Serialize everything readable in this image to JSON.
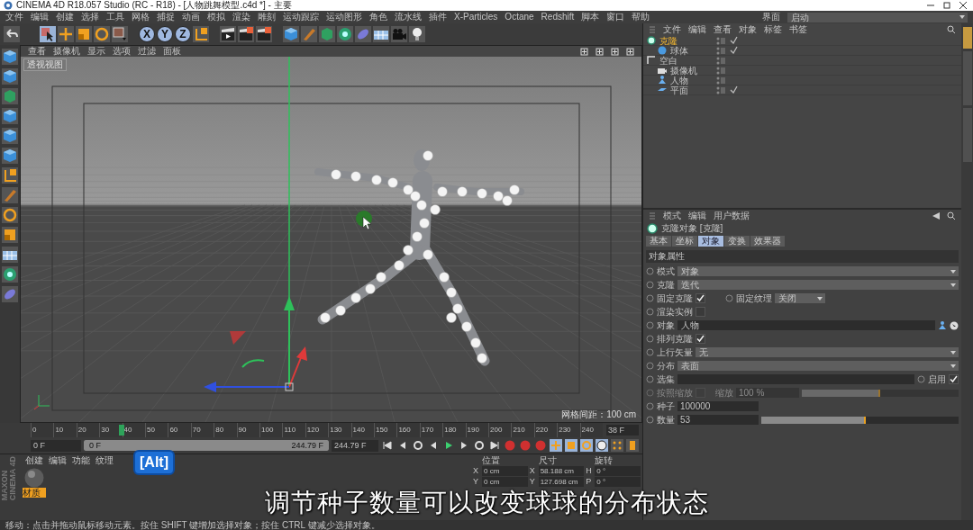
{
  "window": {
    "title": "CINEMA 4D R18.057 Studio (RC - R18) - [人物跳舞模型.c4d *] - 主要"
  },
  "menu": [
    "文件",
    "编辑",
    "创建",
    "选择",
    "工具",
    "网格",
    "捕捉",
    "动画",
    "模拟",
    "渲染",
    "雕刻",
    "运动跟踪",
    "运动图形",
    "角色",
    "流水线",
    "插件",
    "X-Particles",
    "Octane",
    "Redshift",
    "脚本",
    "窗口",
    "帮助"
  ],
  "layout": {
    "label": "界面",
    "value": "启动"
  },
  "axis_lock": [
    {
      "label": "X",
      "on": true
    },
    {
      "label": "Y",
      "on": true
    },
    {
      "label": "Z",
      "on": true
    }
  ],
  "viewport": {
    "menu": [
      "查看",
      "摄像机",
      "显示",
      "选项",
      "过滤",
      "面板"
    ],
    "view_name": "透视视图",
    "grid_spacing": "网格间距：100 cm"
  },
  "object_manager": {
    "menu": [
      "文件",
      "编辑",
      "查看",
      "对象",
      "标签",
      "书签"
    ],
    "objects": [
      {
        "name": "克隆",
        "kind": "cloner",
        "selected": true,
        "enabled": true,
        "children": [
          {
            "name": "球体",
            "kind": "sphere",
            "selected": false,
            "enabled": true
          }
        ]
      },
      {
        "name": "空白",
        "kind": "null",
        "selected": false,
        "enabled": false,
        "children": [
          {
            "name": "摄像机",
            "kind": "camera",
            "selected": false,
            "enabled": false
          },
          {
            "name": "人物",
            "kind": "figure",
            "selected": false,
            "enabled": false
          },
          {
            "name": "平面",
            "kind": "plane",
            "selected": false,
            "enabled": true
          }
        ]
      }
    ]
  },
  "attributes": {
    "menu": [
      "模式",
      "编辑",
      "用户数据"
    ],
    "title": "克隆对象 [克隆]",
    "tabs": [
      {
        "label": "基本",
        "selected": false
      },
      {
        "label": "坐标",
        "selected": false
      },
      {
        "label": "对象",
        "selected": true
      },
      {
        "label": "变换",
        "selected": false
      },
      {
        "label": "效果器",
        "selected": false
      }
    ],
    "section": "对象属性",
    "rows": [
      {
        "kind": "dropdown",
        "label": "模式",
        "value": "对象"
      },
      {
        "kind": "dropdown",
        "label": "克隆",
        "value": "迭代"
      },
      {
        "kind": "check_dropdown",
        "label": "固定克隆",
        "checked": true,
        "label2": "固定纹理",
        "value2": "关闭"
      },
      {
        "kind": "checkbox",
        "label": "渲染实例",
        "checked": false
      },
      {
        "kind": "link",
        "label": "对象",
        "value": "人物"
      },
      {
        "kind": "checkbox",
        "label": "排列克隆",
        "checked": true
      },
      {
        "kind": "dropdown",
        "label": "上行矢量",
        "value": "无"
      },
      {
        "kind": "dropdown",
        "label": "分布",
        "value": "表面"
      },
      {
        "kind": "selection",
        "label": "选集",
        "label2": "启用",
        "checked": true
      },
      {
        "kind": "scale",
        "label": "按照缩放",
        "checked": false,
        "label2": "缩放",
        "value": "100 %",
        "disabled": true,
        "level": 0.5
      },
      {
        "kind": "number",
        "label": "种子",
        "value": "100000"
      },
      {
        "kind": "slider",
        "label": "数量",
        "value": "53",
        "level": 0.53
      }
    ]
  },
  "timeline": {
    "ticks": [
      "0",
      "10",
      "20",
      "30",
      "40",
      "50",
      "60",
      "70",
      "80",
      "90",
      "100",
      "110",
      "120",
      "130",
      "140",
      "150",
      "160",
      "170",
      "180",
      "190",
      "200",
      "210",
      "220",
      "230",
      "240"
    ],
    "playhead": {
      "level": 0.155
    },
    "current_frame": "38 F",
    "start": "0 F",
    "range": {
      "start": "0 F",
      "end": "244.79 F",
      "level": 1
    },
    "end": "244.79 F"
  },
  "materials": {
    "menu": [
      "创建",
      "编辑",
      "功能",
      "纹理"
    ],
    "items": [
      {
        "name": "材质",
        "selected": true
      }
    ]
  },
  "coordinates": {
    "headers": [
      "位置",
      "尺寸",
      "旋转"
    ],
    "rows": [
      [
        "X",
        "0 cm",
        "X",
        "58.188 cm",
        "H",
        "0 °"
      ],
      [
        "Y",
        "0 cm",
        "Y",
        "127.698 cm",
        "P",
        "0 °"
      ]
    ]
  },
  "logo": [
    "MAXON",
    "CINEMA 4D"
  ],
  "side_tabs": [
    {
      "selected": true
    },
    {
      "selected": false
    },
    {
      "selected": false
    }
  ],
  "status_bar": "移动：点击并拖动鼠标移动元素。按住 SHIFT 键增加选择对象；按住 CTRL 键减少选择对象。",
  "key_overlay": "[Alt]",
  "subtitle": "调节种子数量可以改变球球的分布状态"
}
